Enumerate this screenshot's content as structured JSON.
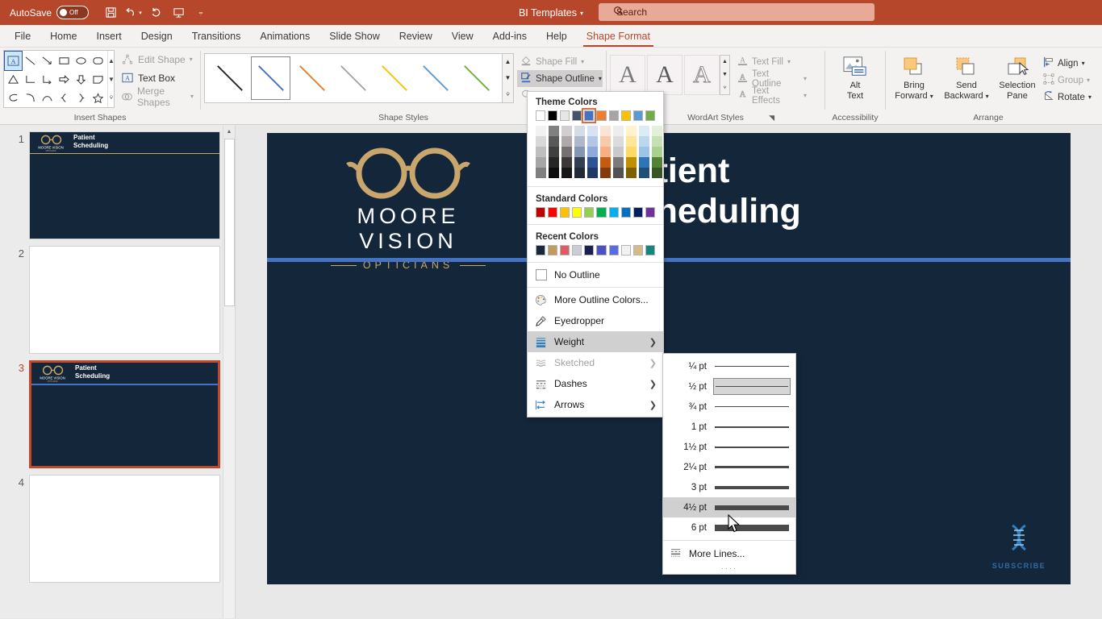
{
  "titlebar": {
    "autosave_label": "AutoSave",
    "autosave_state": "Off",
    "document_title": "BI Templates",
    "search_placeholder": "Search",
    "qat": [
      "save-icon",
      "undo-icon",
      "redo-icon",
      "start-presentation-icon",
      "customize-qat-icon"
    ]
  },
  "tabs": [
    {
      "label": "File",
      "active": false
    },
    {
      "label": "Home",
      "active": false
    },
    {
      "label": "Insert",
      "active": false
    },
    {
      "label": "Design",
      "active": false
    },
    {
      "label": "Transitions",
      "active": false
    },
    {
      "label": "Animations",
      "active": false
    },
    {
      "label": "Slide Show",
      "active": false
    },
    {
      "label": "Review",
      "active": false
    },
    {
      "label": "View",
      "active": false
    },
    {
      "label": "Add-ins",
      "active": false
    },
    {
      "label": "Help",
      "active": false
    },
    {
      "label": "Shape Format",
      "active": true
    }
  ],
  "ribbon": {
    "insert_shapes": {
      "group_label": "Insert Shapes",
      "shapes": [
        "A",
        "\\",
        "\\",
        "▭",
        "◯",
        "▢",
        "△",
        "⌐",
        "⌐",
        "⇨",
        "⇩",
        "⌂",
        "ᘓ",
        "⌒",
        "⌒",
        "{",
        "}",
        "☆"
      ],
      "commands": [
        {
          "label": "Edit Shape",
          "icon": "edit-shape-icon",
          "disabled": true,
          "caret": true
        },
        {
          "label": "Text Box",
          "icon": "text-box-icon",
          "disabled": false,
          "caret": false
        },
        {
          "label": "Merge Shapes",
          "icon": "merge-shapes-icon",
          "disabled": true,
          "caret": true
        }
      ]
    },
    "shape_styles": {
      "group_label": "Shape Styles",
      "items": [
        {
          "name": "style-black",
          "color": "#262626",
          "selected": false
        },
        {
          "name": "style-blue",
          "color": "#4472c4",
          "selected": true
        },
        {
          "name": "style-orange",
          "color": "#ed7d31",
          "selected": false
        },
        {
          "name": "style-gray",
          "color": "#a5a5a5",
          "selected": false
        },
        {
          "name": "style-yellow",
          "color": "#ffc000",
          "selected": false
        },
        {
          "name": "style-lightblue",
          "color": "#5b9bd5",
          "selected": false
        },
        {
          "name": "style-green",
          "color": "#70ad47",
          "selected": false
        }
      ],
      "commands": [
        {
          "label": "Shape Fill",
          "icon": "shape-fill-icon",
          "disabled": true,
          "active": false
        },
        {
          "label": "Shape Outline",
          "icon": "shape-outline-icon",
          "disabled": false,
          "active": true
        },
        {
          "label": "Shape Effects",
          "icon": "shape-effects-icon",
          "disabled": true,
          "active": false
        }
      ]
    },
    "wordart_styles": {
      "group_label": "WordArt Styles",
      "previews": [
        "A",
        "A",
        "A"
      ],
      "commands": [
        {
          "label": "Text Fill",
          "icon": "text-fill-icon"
        },
        {
          "label": "Text Outline",
          "icon": "text-outline-icon"
        },
        {
          "label": "Text Effects",
          "icon": "text-effects-icon"
        }
      ]
    },
    "accessibility": {
      "group_label": "Accessibility",
      "alt_text_line1": "Alt",
      "alt_text_line2": "Text"
    },
    "arrange": {
      "group_label": "Arrange",
      "bring_forward_line1": "Bring",
      "bring_forward_line2": "Forward",
      "send_backward_line1": "Send",
      "send_backward_line2": "Backward",
      "selection_pane_line1": "Selection",
      "selection_pane_line2": "Pane",
      "commands": [
        {
          "label": "Align",
          "icon": "align-icon",
          "disabled": false
        },
        {
          "label": "Group",
          "icon": "group-icon",
          "disabled": true
        },
        {
          "label": "Rotate",
          "icon": "rotate-icon",
          "disabled": false
        }
      ]
    }
  },
  "thumbnails": [
    {
      "number": "1",
      "selected": false,
      "blank": false,
      "title_line1": "Patient",
      "title_line2": "Scheduling",
      "rule_color": "#c9a66b"
    },
    {
      "number": "2",
      "selected": false,
      "blank": true,
      "title_line1": "",
      "title_line2": "",
      "rule_color": ""
    },
    {
      "number": "3",
      "selected": true,
      "blank": false,
      "title_line1": "Patient",
      "title_line2": "Scheduling",
      "rule_color": "#4472c4"
    },
    {
      "number": "4",
      "selected": false,
      "blank": true,
      "title_line1": "",
      "title_line2": "",
      "rule_color": ""
    }
  ],
  "slide": {
    "logo_name": "MOORE VISION",
    "logo_subtitle": "OPTICIANS",
    "title_line1": "Patient",
    "title_line2": "Scheduling",
    "background_color": "#13263a",
    "rule_color": "#4472c4",
    "accent_gold": "#c9a66b",
    "watermark_label": "SUBSCRIBE"
  },
  "outline_menu": {
    "theme_colors_heading": "Theme Colors",
    "theme_colors": [
      {
        "name": "white",
        "hex": "#ffffff",
        "selected": false
      },
      {
        "name": "black",
        "hex": "#000000",
        "selected": false
      },
      {
        "name": "light-gray",
        "hex": "#e7e6e6",
        "selected": false
      },
      {
        "name": "dark-slate",
        "hex": "#44546a",
        "selected": false
      },
      {
        "name": "blue",
        "hex": "#4472c4",
        "selected": true
      },
      {
        "name": "orange",
        "hex": "#ed7d31",
        "selected": false
      },
      {
        "name": "gray",
        "hex": "#a5a5a5",
        "selected": false
      },
      {
        "name": "yellow",
        "hex": "#ffc000",
        "selected": false
      },
      {
        "name": "light-blue",
        "hex": "#5b9bd5",
        "selected": false
      },
      {
        "name": "green",
        "hex": "#70ad47",
        "selected": false
      }
    ],
    "standard_colors_heading": "Standard Colors",
    "standard_colors": [
      {
        "name": "dark-red",
        "hex": "#c00000"
      },
      {
        "name": "red",
        "hex": "#ff0000"
      },
      {
        "name": "orange",
        "hex": "#ffc000"
      },
      {
        "name": "yellow",
        "hex": "#ffff00"
      },
      {
        "name": "light-green",
        "hex": "#92d050"
      },
      {
        "name": "green",
        "hex": "#00b050"
      },
      {
        "name": "light-blue",
        "hex": "#00b0f0"
      },
      {
        "name": "blue",
        "hex": "#0070c0"
      },
      {
        "name": "dark-blue",
        "hex": "#002060"
      },
      {
        "name": "purple",
        "hex": "#7030a0"
      }
    ],
    "recent_colors_heading": "Recent Colors",
    "recent_colors": [
      {
        "name": "recent-1",
        "hex": "#17293d"
      },
      {
        "name": "recent-2",
        "hex": "#bf9b5e"
      },
      {
        "name": "recent-3",
        "hex": "#e15a63"
      },
      {
        "name": "recent-4",
        "hex": "#c9ccd4"
      },
      {
        "name": "recent-5",
        "hex": "#1b1f50"
      },
      {
        "name": "recent-6",
        "hex": "#4f4fc4"
      },
      {
        "name": "recent-7",
        "hex": "#5a6de0"
      },
      {
        "name": "recent-8",
        "hex": "#f2f2f2"
      },
      {
        "name": "recent-9",
        "hex": "#d5bb8c"
      },
      {
        "name": "recent-10",
        "hex": "#13877f"
      }
    ],
    "items": [
      {
        "label": "No Outline",
        "icon": "no-outline-swatch-icon",
        "highlighted": false,
        "disabled": false,
        "submenu": false
      },
      {
        "label": "More Outline Colors...",
        "icon": "palette-icon",
        "highlighted": false,
        "disabled": false,
        "submenu": false
      },
      {
        "label": "Eyedropper",
        "icon": "eyedropper-icon",
        "highlighted": false,
        "disabled": false,
        "submenu": false
      },
      {
        "label": "Weight",
        "icon": "weight-icon",
        "highlighted": true,
        "disabled": false,
        "submenu": true
      },
      {
        "label": "Sketched",
        "icon": "sketched-icon",
        "highlighted": false,
        "disabled": true,
        "submenu": true
      },
      {
        "label": "Dashes",
        "icon": "dashes-icon",
        "highlighted": false,
        "disabled": false,
        "submenu": true
      },
      {
        "label": "Arrows",
        "icon": "arrows-icon",
        "highlighted": false,
        "disabled": false,
        "submenu": true
      }
    ]
  },
  "weight_submenu": {
    "items": [
      {
        "label": "¼ pt",
        "thickness_px": 1,
        "selected": false,
        "highlighted": false
      },
      {
        "label": "½ pt",
        "thickness_px": 1,
        "selected": true,
        "highlighted": false
      },
      {
        "label": "¾ pt",
        "thickness_px": 1,
        "selected": false,
        "highlighted": false
      },
      {
        "label": "1 pt",
        "thickness_px": 2,
        "selected": false,
        "highlighted": false
      },
      {
        "label": "1½ pt",
        "thickness_px": 2,
        "selected": false,
        "highlighted": false
      },
      {
        "label": "2¼ pt",
        "thickness_px": 3,
        "selected": false,
        "highlighted": false
      },
      {
        "label": "3 pt",
        "thickness_px": 4,
        "selected": false,
        "highlighted": false
      },
      {
        "label": "4½ pt",
        "thickness_px": 6,
        "selected": false,
        "highlighted": true
      },
      {
        "label": "6 pt",
        "thickness_px": 8,
        "selected": false,
        "highlighted": false
      }
    ],
    "more_lines_label": "More Lines...",
    "more_lines_icon": "more-lines-icon"
  }
}
